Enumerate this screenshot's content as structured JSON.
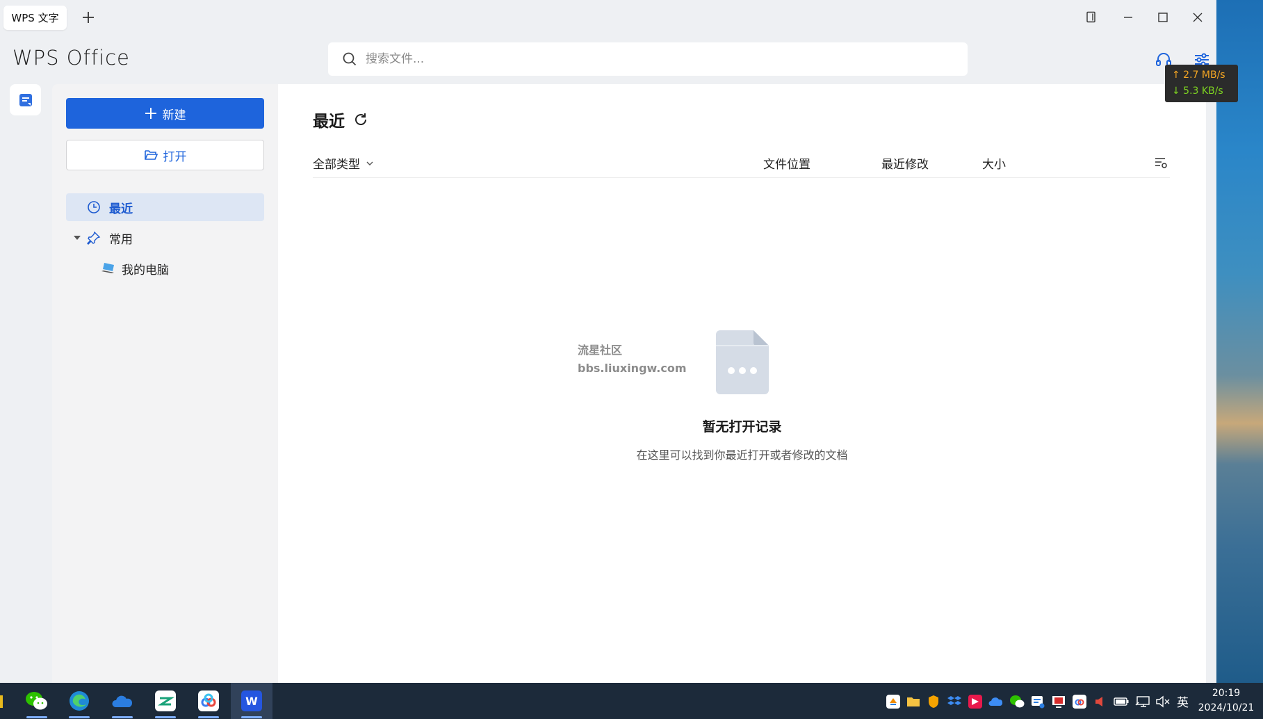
{
  "titlebar": {
    "tab_label": "WPS 文字",
    "new_tab_icon": "plus-icon",
    "controls": [
      "restore-layout-icon",
      "minimize-icon",
      "maximize-icon",
      "close-icon"
    ]
  },
  "header": {
    "logo": "WPS Office",
    "search_placeholder": "搜索文件...",
    "icons": [
      "headset-icon",
      "settings-sliders-icon"
    ]
  },
  "net_monitor": {
    "upload": "↑ 2.7 MB/s",
    "download": "↓ 5.3 KB/s",
    "upload_color": "#f5a623",
    "download_color": "#7ed321"
  },
  "sidebar": {
    "new_label": "新建",
    "open_label": "打开",
    "nav": {
      "recent": "最近",
      "common": "常用",
      "my_pc": "我的电脑"
    }
  },
  "main": {
    "title": "最近",
    "columns": {
      "type_filter": "全部类型",
      "location": "文件位置",
      "modified": "最近修改",
      "size": "大小"
    },
    "empty_title": "暂无打开记录",
    "empty_subtitle": "在这里可以找到你最近打开或者修改的文档"
  },
  "watermark": {
    "line1": "流星社区",
    "line2": "bbs.liuxingw.com"
  },
  "taskbar": {
    "apps": [
      "wechat-icon",
      "edge-icon",
      "onedrive-icon",
      "app-cloud-icon",
      "baidu-netdisk-icon",
      "wps-writer-icon"
    ],
    "active_app": "wps-writer-icon",
    "tray_icons": [
      "app1-icon",
      "folder-icon",
      "shield-icon",
      "dropbox-icon",
      "app2-icon",
      "onedrive-tray-icon",
      "wechat-tray-icon",
      "app3-icon",
      "app4-icon",
      "app5-icon",
      "speaker-red-icon",
      "battery-icon",
      "network-icon",
      "volume-mute-icon"
    ],
    "language": "英",
    "time": "20:19",
    "date": "2024/10/21"
  },
  "colors": {
    "accent": "#1e64dc",
    "nav_selected_bg": "#dde6f4",
    "taskbar_bg": "#1c2a3a"
  }
}
